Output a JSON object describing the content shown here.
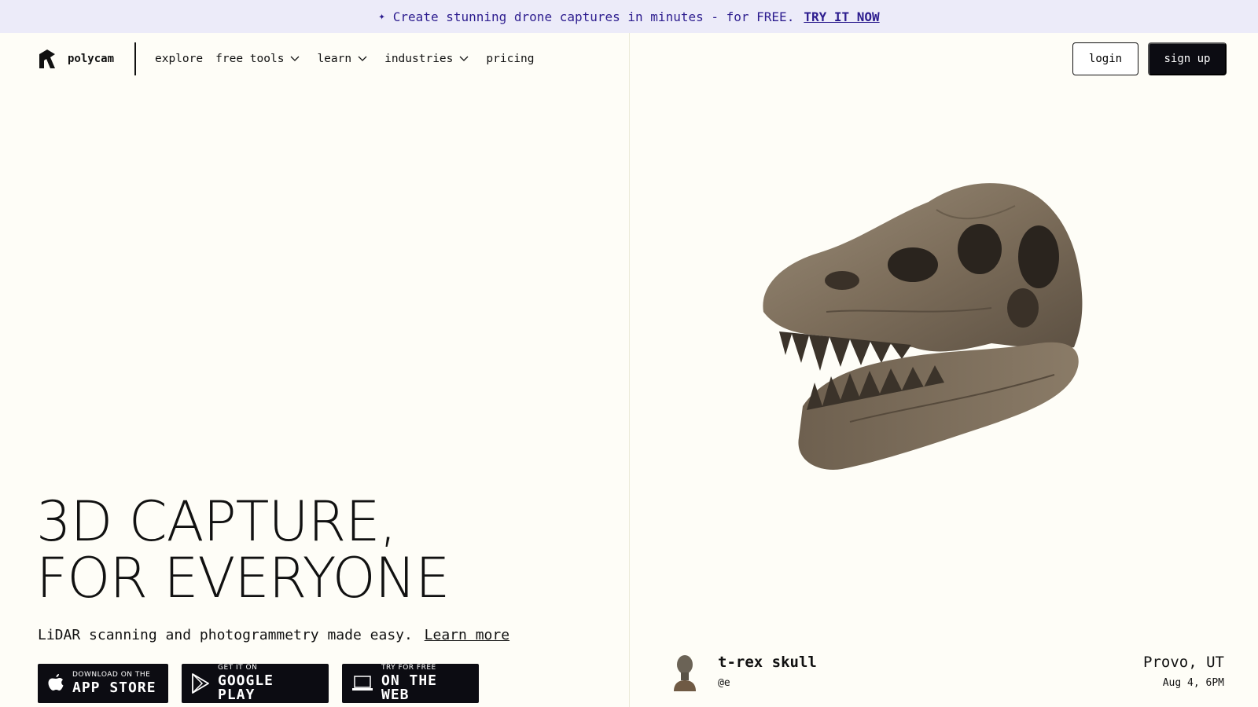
{
  "banner": {
    "icon": "drone-icon",
    "text": "Create stunning drone captures in minutes - for FREE.",
    "link": "TRY IT NOW"
  },
  "header": {
    "logo_text": "polycam",
    "nav": [
      {
        "label": "explore",
        "dropdown": false
      },
      {
        "label": "free tools",
        "dropdown": true
      },
      {
        "label": "learn",
        "dropdown": true
      },
      {
        "label": "industries",
        "dropdown": true
      },
      {
        "label": "pricing",
        "dropdown": false
      }
    ],
    "login": "login",
    "signup": "sign up"
  },
  "hero": {
    "title_line1": "3D CAPTURE,",
    "title_line2": "FOR EVERYONE",
    "tagline": "LiDAR scanning and photogrammetry made easy.",
    "learn_more": "Learn more"
  },
  "stores": [
    {
      "small": "DOWNLOAD ON THE",
      "big": "APP STORE",
      "icon": "apple-icon"
    },
    {
      "small": "GET IT ON",
      "big": "GOOGLE PLAY",
      "icon": "google-play-icon"
    },
    {
      "small": "TRY FOR FREE",
      "big": "ON THE WEB",
      "icon": "laptop-icon"
    }
  ],
  "showcase": {
    "title": "t-rex skull",
    "user": "@e",
    "location": "Provo, UT",
    "time": "Aug 4, 6PM"
  },
  "colors": {
    "banner_bg": "#ecebf9",
    "banner_text": "#2d1d8f",
    "page_bg": "#fefdf7",
    "dark": "#0c0c12"
  }
}
